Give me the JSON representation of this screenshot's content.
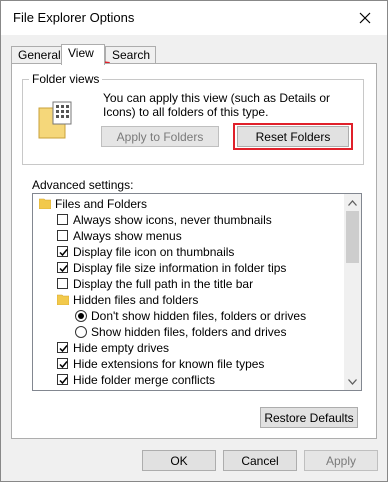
{
  "window": {
    "title": "File Explorer Options"
  },
  "tabs": [
    {
      "label": "General",
      "active": false
    },
    {
      "label": "View",
      "active": true
    },
    {
      "label": "Search",
      "active": false
    }
  ],
  "folder_views": {
    "group_label": "Folder views",
    "description": "You can apply this view (such as Details or Icons) to all folders of this type.",
    "apply_button": "Apply to Folders",
    "reset_button": "Reset Folders"
  },
  "advanced": {
    "label": "Advanced settings:",
    "items": [
      {
        "type": "folder",
        "label": "Files and Folders",
        "indent": 0
      },
      {
        "type": "checkbox",
        "label": "Always show icons, never thumbnails",
        "checked": false,
        "indent": 1
      },
      {
        "type": "checkbox",
        "label": "Always show menus",
        "checked": false,
        "indent": 1
      },
      {
        "type": "checkbox",
        "label": "Display file icon on thumbnails",
        "checked": true,
        "indent": 1
      },
      {
        "type": "checkbox",
        "label": "Display file size information in folder tips",
        "checked": true,
        "indent": 1
      },
      {
        "type": "checkbox",
        "label": "Display the full path in the title bar",
        "checked": false,
        "indent": 1
      },
      {
        "type": "folder",
        "label": "Hidden files and folders",
        "indent": 1
      },
      {
        "type": "radio",
        "label": "Don't show hidden files, folders or drives",
        "checked": true,
        "indent": 2
      },
      {
        "type": "radio",
        "label": "Show hidden files, folders and drives",
        "checked": false,
        "indent": 2
      },
      {
        "type": "checkbox",
        "label": "Hide empty drives",
        "checked": true,
        "indent": 1
      },
      {
        "type": "checkbox",
        "label": "Hide extensions for known file types",
        "checked": true,
        "indent": 1
      },
      {
        "type": "checkbox",
        "label": "Hide folder merge conflicts",
        "checked": true,
        "indent": 1
      }
    ]
  },
  "restore_defaults": "Restore Defaults",
  "footer": {
    "ok": "OK",
    "cancel": "Cancel",
    "apply": "Apply"
  },
  "colors": {
    "highlight": "#e0202a",
    "folder": "#f2c94c"
  }
}
